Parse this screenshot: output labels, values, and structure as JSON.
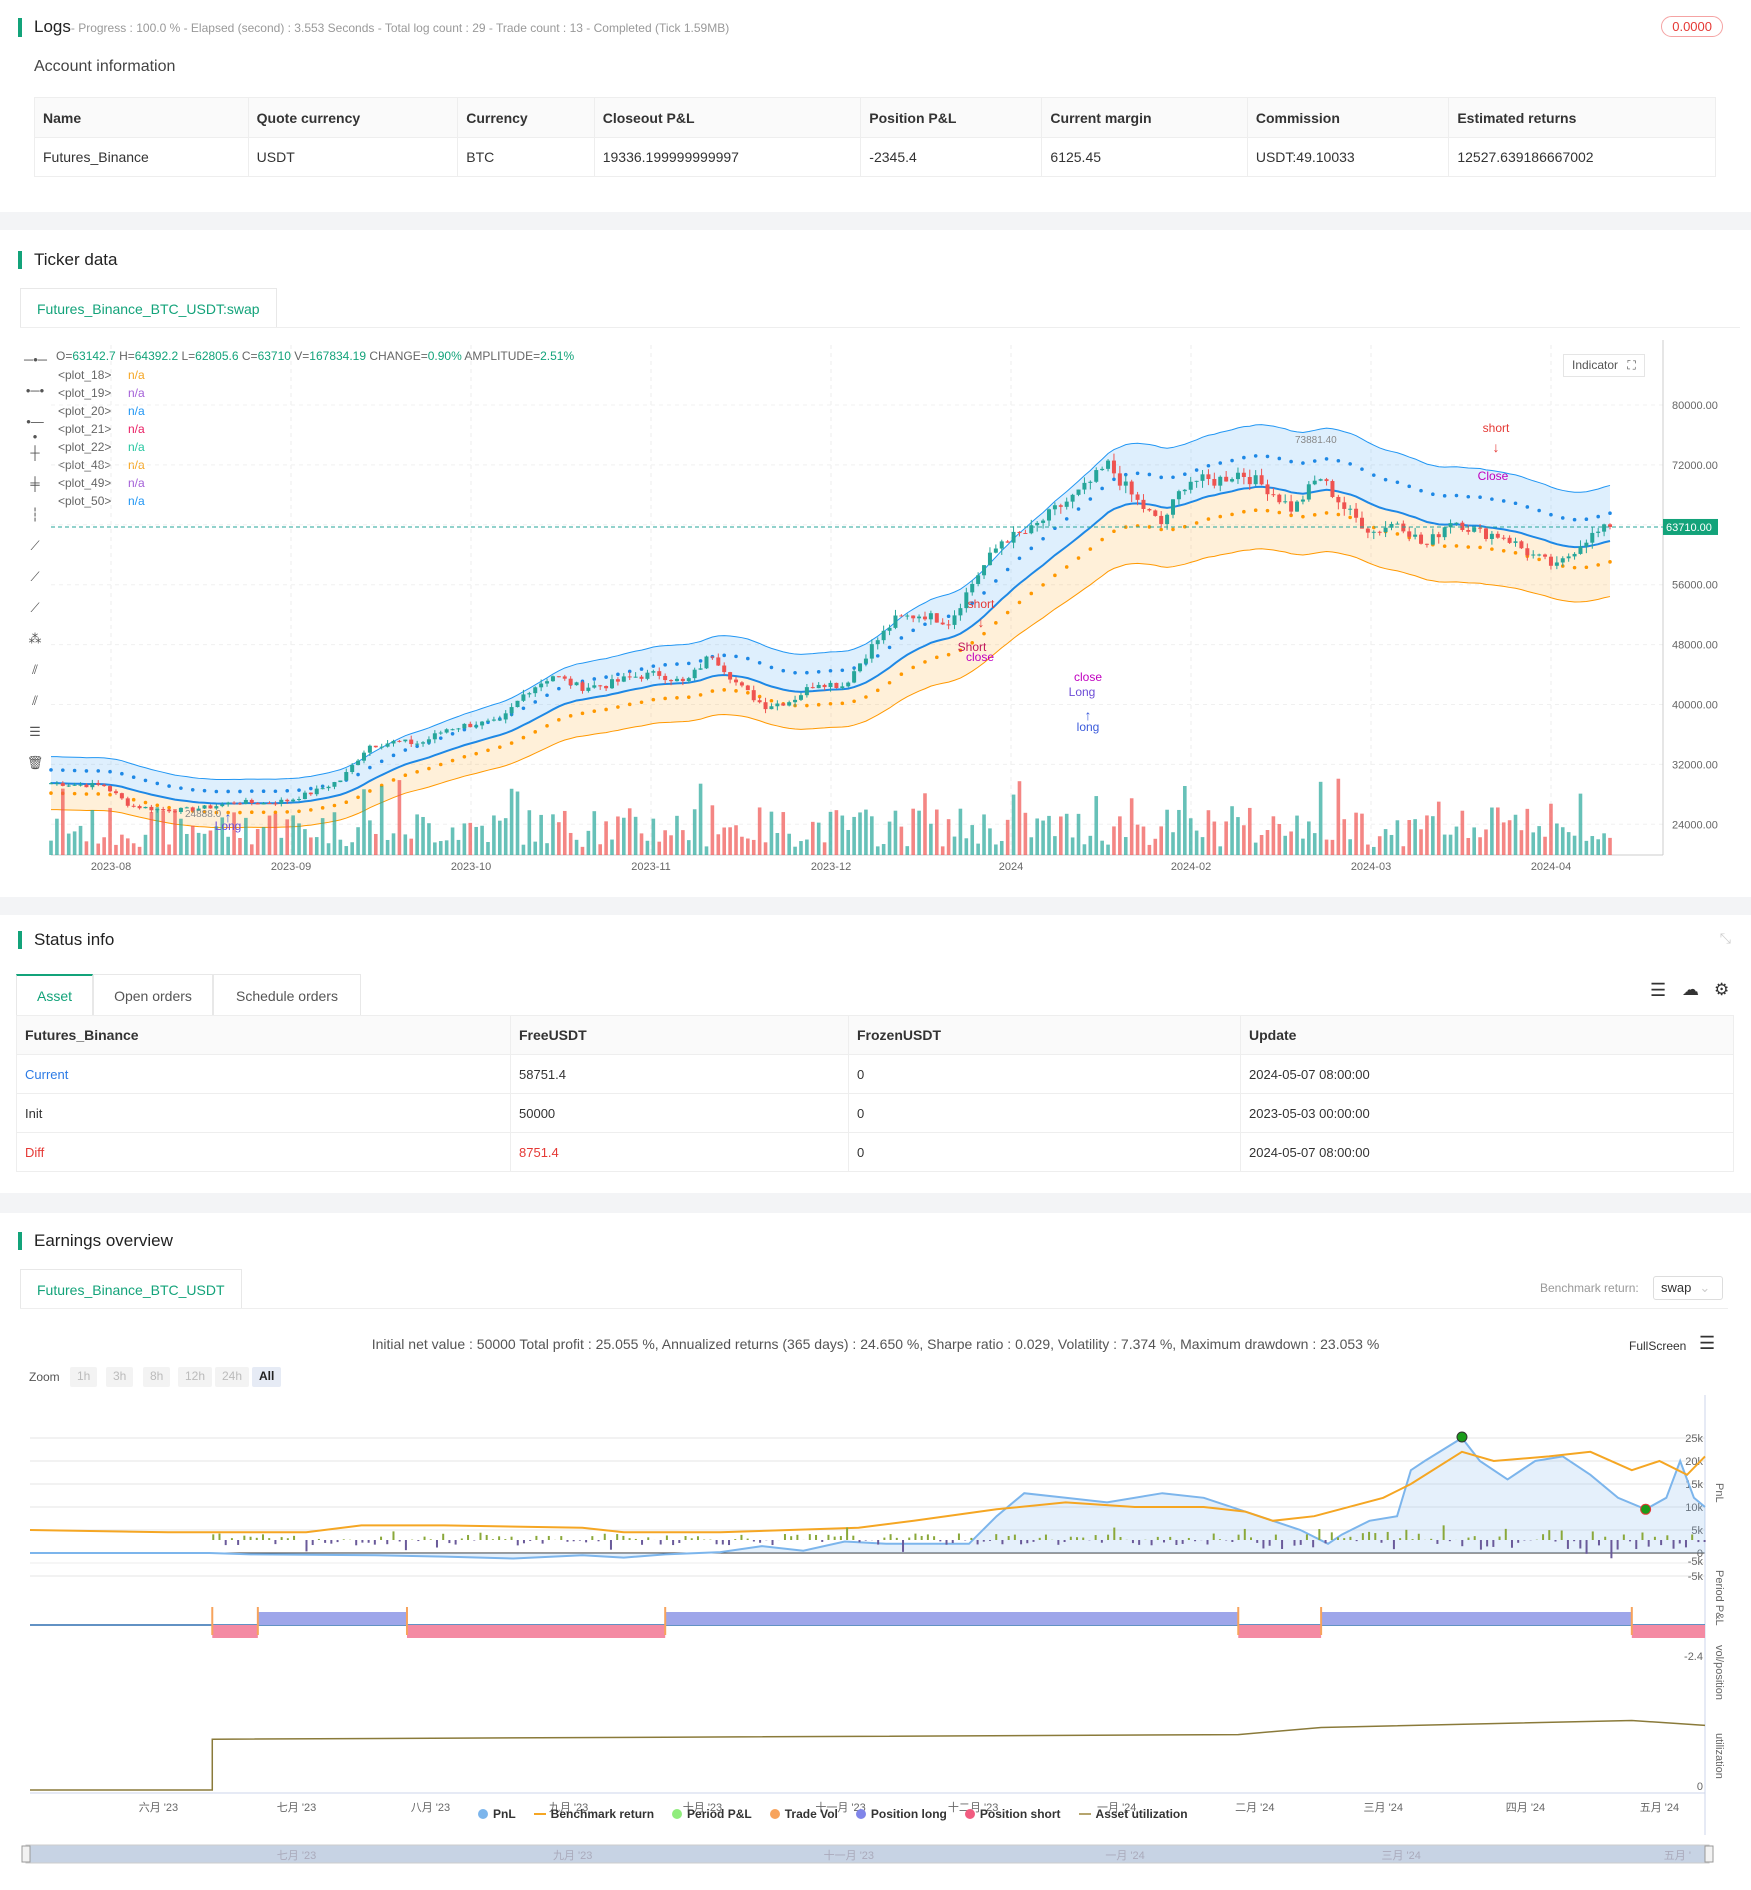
{
  "logs": {
    "title": "Logs",
    "summary": "- Progress : 100.0 % - Elapsed (second) : 3.553  Seconds - Total log count : 29 - Trade count : 13 - Completed (Tick 1.59MB)",
    "badge": "0.0000"
  },
  "account": {
    "title": "Account information",
    "headers": [
      "Name",
      "Quote currency",
      "Currency",
      "Closeout P&L",
      "Position P&L",
      "Current margin",
      "Commission",
      "Estimated returns"
    ],
    "row": [
      "Futures_Binance",
      "USDT",
      "BTC",
      "19336.199999999997",
      "-2345.4",
      "6125.45",
      "USDT:49.10033",
      "12527.639186667002"
    ]
  },
  "ticker": {
    "title": "Ticker data",
    "tab": "Futures_Binance_BTC_USDT:swap",
    "ohlc": {
      "O": "63142.7",
      "H": "64392.2",
      "L": "62805.6",
      "C": "63710",
      "V": "167834.19",
      "CHANGE": "0.90%",
      "AMPLITUDE": "2.51%"
    },
    "plots": [
      {
        "name": "<plot_18>",
        "val": "n/a",
        "color": "#f5a623"
      },
      {
        "name": "<plot_19>",
        "val": "n/a",
        "color": "#a461d8"
      },
      {
        "name": "<plot_20>",
        "val": "n/a",
        "color": "#2196f3"
      },
      {
        "name": "<plot_21>",
        "val": "n/a",
        "color": "#e91e63"
      },
      {
        "name": "<plot_22>",
        "val": "n/a",
        "color": "#26c6a0"
      },
      {
        "name": "<plot_48>",
        "val": "n/a",
        "color": "#f5a623"
      },
      {
        "name": "<plot_49>",
        "val": "n/a",
        "color": "#a461d8"
      },
      {
        "name": "<plot_50>",
        "val": "n/a",
        "color": "#2196f3"
      }
    ],
    "indicator_label": "Indicator",
    "last_price": "63710.00",
    "high_label": "73881.40",
    "low_label": "24888.0",
    "price_ticks": [
      "80000.00",
      "72000.00",
      "64000.00",
      "56000.00",
      "48000.00",
      "40000.00",
      "32000.00",
      "24000.00"
    ],
    "time_ticks": [
      "2023-08",
      "2023-09",
      "2023-10",
      "2023-11",
      "2023-12",
      "2024",
      "2024-02",
      "2024-03",
      "2024-04"
    ],
    "price_anchors": [
      29500,
      29300,
      29200,
      26500,
      26000,
      25900,
      26300,
      27000,
      26800,
      27200,
      28400,
      30000,
      34500,
      35000,
      34800,
      36800,
      37400,
      37600,
      41800,
      43900,
      42300,
      42600,
      43700,
      44100,
      42800,
      46800,
      42600,
      39800,
      40500,
      43000,
      42500,
      47500,
      51500,
      52000,
      51000,
      57000,
      62000,
      63000,
      66000,
      68500,
      72000,
      67500,
      64000,
      70000,
      69800,
      71000,
      69000,
      66000,
      70500,
      66000,
      63000,
      64500,
      61000,
      64800,
      63000,
      62500,
      60000,
      58300,
      62000,
      63710
    ],
    "annotations": [
      {
        "text": "short",
        "color": "#e53935"
      },
      {
        "text": "Short",
        "color": "#c2185b"
      },
      {
        "text": "close",
        "color": "#c000c0"
      },
      {
        "text": "close",
        "color": "#c000c0"
      },
      {
        "text": "Long",
        "color": "#6d4dd6"
      },
      {
        "text": "long",
        "color": "#3b5bdb"
      },
      {
        "text": "short",
        "color": "#e53935"
      },
      {
        "text": "Close",
        "color": "#c000c0"
      },
      {
        "text": "Long",
        "color": "#6d4dd6"
      }
    ]
  },
  "status": {
    "title": "Status info",
    "tabs": [
      "Asset",
      "Open orders",
      "Schedule orders"
    ],
    "headers": [
      "Futures_Binance",
      "FreeUSDT",
      "FrozenUSDT",
      "Update"
    ],
    "rows": [
      [
        "Current",
        "58751.4",
        "0",
        "2024-05-07 08:00:00"
      ],
      [
        "Init",
        "50000",
        "0",
        "2023-05-03 00:00:00"
      ],
      [
        "Diff",
        "8751.4",
        "0",
        "2024-05-07 08:00:00"
      ]
    ]
  },
  "earnings": {
    "title": "Earnings overview",
    "tab": "Futures_Binance_BTC_USDT",
    "benchmark_label": "Benchmark return:",
    "benchmark_value": "swap",
    "stats": "Initial net value : 50000 Total profit : 25.055 %, Annualized returns (365 days) : 24.650 %, Sharpe ratio : 0.029, Volatility : 7.374 %, Maximum drawdown : 23.053 %",
    "fullscreen": "FullScreen",
    "zoom_label": "Zoom",
    "zoom_options": [
      "1h",
      "3h",
      "8h",
      "12h",
      "24h",
      "All"
    ],
    "pnl_ticks": [
      "25k",
      "20k",
      "15k",
      "10k",
      "5k",
      "0",
      "-5k"
    ],
    "pnl_axis": "PnL",
    "period_axis": "Period P&L",
    "period_tick": "-5k",
    "pos_axis": "vol/position",
    "pos_tick": "-2.4",
    "util_axis": "utilization",
    "util_tick": "0",
    "months": [
      "六月 '23",
      "七月 '23",
      "八月 '23",
      "九月 '23",
      "十月 '23",
      "十一月 '23",
      "十二月 '23",
      "一月 '24",
      "二月 '24",
      "三月 '24",
      "四月 '24",
      "五月 '24"
    ],
    "nav_months": [
      "七月 '23",
      "九月 '23",
      "十一月 '23",
      "一月 '24",
      "三月 '24",
      "五月 '"
    ],
    "legend": [
      {
        "label": "PnL",
        "color": "#7cb5ec"
      },
      {
        "label": "Benchmark return",
        "color": "#f5a623"
      },
      {
        "label": "Period P&L",
        "color": "#90ed7d"
      },
      {
        "label": "Trade Vol",
        "color": "#f7a35c"
      },
      {
        "label": "Position long",
        "color": "#8085e9"
      },
      {
        "label": "Position short",
        "color": "#f15c80"
      },
      {
        "label": "Asset utilization",
        "color": "#b5a46d"
      }
    ],
    "chart_data": {
      "type": "line",
      "x_unit": "months since 2023-05-03",
      "ylabel": "PnL",
      "pnl": [
        [
          0,
          0
        ],
        [
          1.3,
          0
        ],
        [
          1.6,
          -0.3
        ],
        [
          2.5,
          -0.5
        ],
        [
          3.0,
          -0.8
        ],
        [
          3.5,
          -1.2
        ],
        [
          4.0,
          -0.5
        ],
        [
          4.3,
          -1
        ],
        [
          4.6,
          -0.3
        ],
        [
          5.0,
          0.2
        ],
        [
          5.3,
          1.5
        ],
        [
          5.6,
          0.5
        ],
        [
          5.9,
          2.5
        ],
        [
          6.2,
          2
        ],
        [
          6.8,
          2
        ],
        [
          7.0,
          8
        ],
        [
          7.2,
          13
        ],
        [
          7.5,
          12
        ],
        [
          7.8,
          11
        ],
        [
          8.2,
          13
        ],
        [
          8.5,
          12
        ],
        [
          8.8,
          9
        ],
        [
          9.0,
          7
        ],
        [
          9.2,
          5
        ],
        [
          9.4,
          2
        ],
        [
          9.5,
          4
        ],
        [
          9.7,
          7
        ],
        [
          9.9,
          8
        ],
        [
          10.0,
          18
        ],
        [
          10.1,
          20
        ],
        [
          10.37,
          25
        ],
        [
          10.5,
          20
        ],
        [
          10.7,
          16
        ],
        [
          10.9,
          20
        ],
        [
          11.1,
          21
        ],
        [
          11.3,
          17
        ],
        [
          11.5,
          12
        ],
        [
          11.7,
          9.5
        ],
        [
          11.85,
          12
        ],
        [
          11.95,
          20
        ],
        [
          12.05,
          12
        ],
        [
          12.13,
          10
        ]
      ],
      "benchmark": [
        [
          0,
          5
        ],
        [
          1,
          4.5
        ],
        [
          2,
          4.5
        ],
        [
          2.4,
          6
        ],
        [
          3,
          6
        ],
        [
          4,
          5.5
        ],
        [
          4.3,
          4.5
        ],
        [
          5,
          4.5
        ],
        [
          5.5,
          5
        ],
        [
          6,
          5.5
        ],
        [
          6.4,
          7
        ],
        [
          7,
          9.5
        ],
        [
          7.5,
          11
        ],
        [
          8,
          10
        ],
        [
          8.5,
          10
        ],
        [
          8.8,
          9
        ],
        [
          9.0,
          7
        ],
        [
          9.3,
          8
        ],
        [
          9.8,
          12
        ],
        [
          10.0,
          15
        ],
        [
          10.37,
          22
        ],
        [
          10.6,
          20
        ],
        [
          11.0,
          21
        ],
        [
          11.3,
          22
        ],
        [
          11.6,
          18
        ],
        [
          11.8,
          20
        ],
        [
          12.0,
          17
        ],
        [
          12.13,
          21
        ]
      ],
      "positions": [
        [
          "short",
          1.32,
          1.65
        ],
        [
          "long",
          1.65,
          2.73
        ],
        [
          "short",
          2.73,
          4.6
        ],
        [
          "long",
          4.6,
          8.75
        ],
        [
          "short",
          8.75,
          9.35
        ],
        [
          "long",
          9.35,
          11.6
        ],
        [
          "short",
          11.6,
          12.13
        ]
      ],
      "utilization": [
        [
          0,
          0
        ],
        [
          1.32,
          0
        ],
        [
          1.32,
          0.45
        ],
        [
          4.6,
          0.47
        ],
        [
          8.75,
          0.5
        ],
        [
          9.35,
          0.58
        ],
        [
          11.6,
          0.62
        ],
        [
          12.13,
          0.6
        ]
      ]
    }
  }
}
